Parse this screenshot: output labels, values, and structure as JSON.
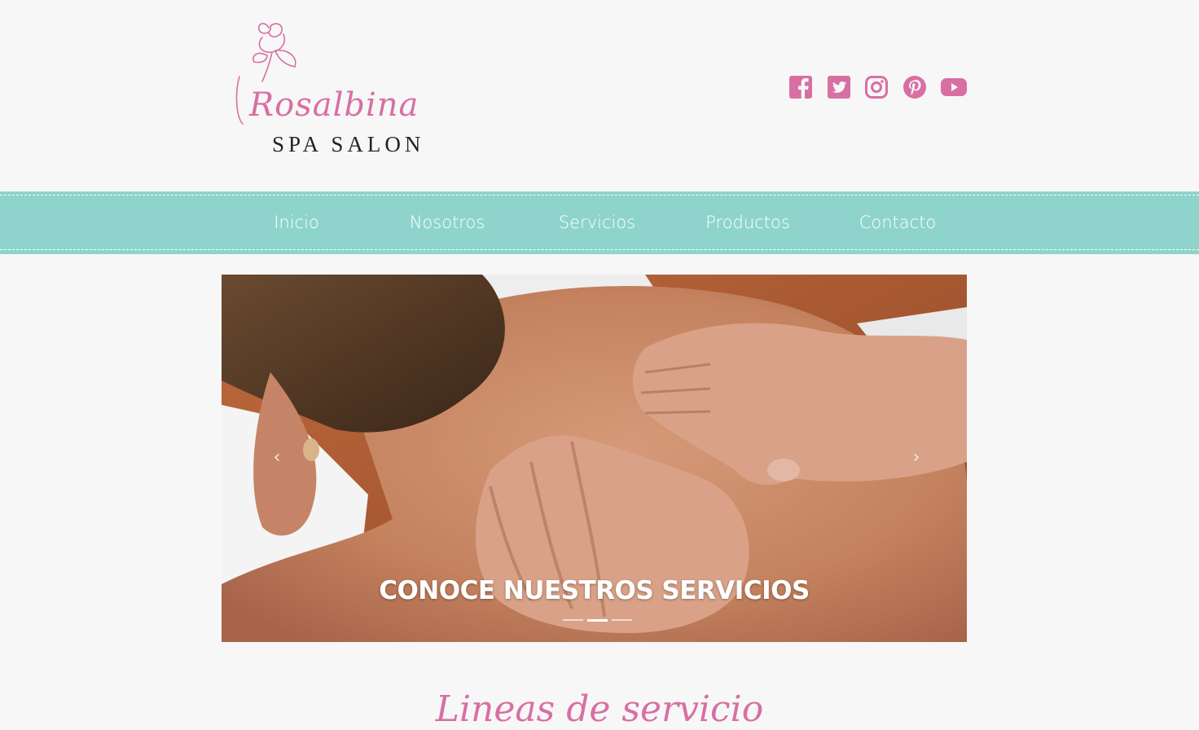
{
  "brand": {
    "name": "Rosalbina",
    "tagline": "SPA SALON",
    "accent": "#d86fa3"
  },
  "social": [
    {
      "name": "facebook-icon"
    },
    {
      "name": "twitter-icon"
    },
    {
      "name": "instagram-icon"
    },
    {
      "name": "pinterest-icon"
    },
    {
      "name": "youtube-icon"
    }
  ],
  "nav": {
    "background": "#8ed4cc",
    "items": [
      "Inicio",
      "Nosotros",
      "Servicios",
      "Productos",
      "Contacto"
    ]
  },
  "carousel": {
    "caption": "CONOCE NUESTROS SERVICIOS",
    "prev_icon": "‹",
    "next_icon": "›",
    "slides": 3,
    "active_slide": 2
  },
  "section": {
    "title": "Lineas de servicio"
  }
}
